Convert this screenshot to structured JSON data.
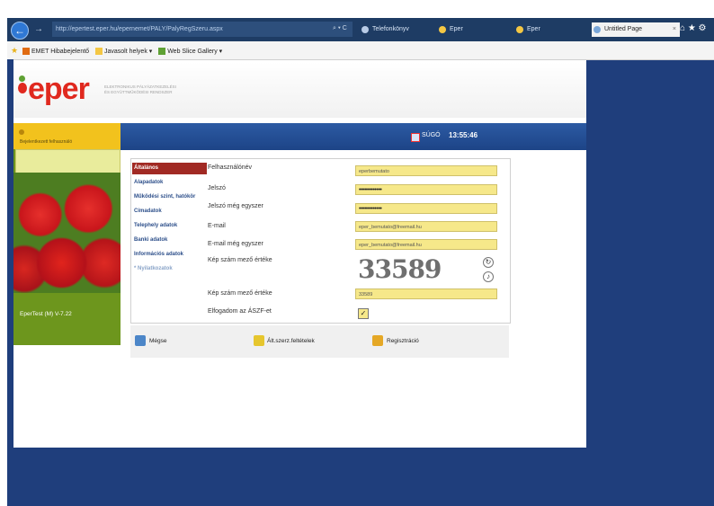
{
  "browser": {
    "address": "http://epertest.eper.hu/epernemet/PALY/PalyRegSzeru.aspx",
    "search_symbol": "⌕ ▾ C",
    "tabs": [
      {
        "label": "Telefonkönyv"
      },
      {
        "label": "Eper"
      },
      {
        "label": "Eper"
      },
      {
        "label": "Untitled Page"
      }
    ],
    "close_symbol": "×",
    "toolbar_icons": "⌂ ★ ⚙"
  },
  "favorites": {
    "items": [
      {
        "label": "EMET Hibabejelentő"
      },
      {
        "label": "Javasolt helyek ▾"
      },
      {
        "label": "Web Slice Gallery ▾"
      }
    ]
  },
  "header": {
    "logo": "eper",
    "tagline_1": "ELEKTRONIKUS PÁLYÁZATKEZELÉSI",
    "tagline_2": "ÉS EGYÜTTMŰKÖDÉSI RENDSZER"
  },
  "topbar": {
    "help": "SÚGÓ",
    "time": "13:55:46"
  },
  "left": {
    "user_title": "Bejelentkezett felhasználó",
    "version": "EperTest (M) V-7.22"
  },
  "menu": [
    {
      "label": "Általános"
    },
    {
      "label": "Alapadatok"
    },
    {
      "label": "Működési szint, hatókör"
    },
    {
      "label": "Címadatok"
    },
    {
      "label": "Telephely adatok"
    },
    {
      "label": "Banki adatok"
    },
    {
      "label": "Információs adatok"
    },
    {
      "label": "* Nyilatkozatok"
    }
  ],
  "form": {
    "username_label": "Felhasználónév",
    "username_value": "eperbemutato",
    "password_label": "Jelszó",
    "password_value": "•••••••••••••",
    "password2_label": "Jelszó még egyszer",
    "password2_value": "•••••••••••••",
    "email_label": "E-mail",
    "email_value": "eper_bemutato@freemail.hu",
    "email2_label": "E-mail még egyszer",
    "email2_value": "eper_bemutato@freemail.hu",
    "captcha_label": "Kép szám mező értéke",
    "captcha_image_text": "33589",
    "captcha_refresh": "↻",
    "captcha_audio": "♪",
    "captcha_input_label": "Kép szám mező értéke",
    "captcha_input_value": "33589",
    "aszf_label": "Elfogadom az ÁSZF-et",
    "aszf_check": "✓"
  },
  "buttons": {
    "cancel": "Mégse",
    "terms": "Ált.szerz.feltételek",
    "register": "Regisztráció"
  },
  "colors": {
    "accent_blue": "#1f3e7c",
    "menu_active": "#a12a24",
    "input_yellow": "#f6e88a",
    "logo_red": "#e0291f"
  }
}
